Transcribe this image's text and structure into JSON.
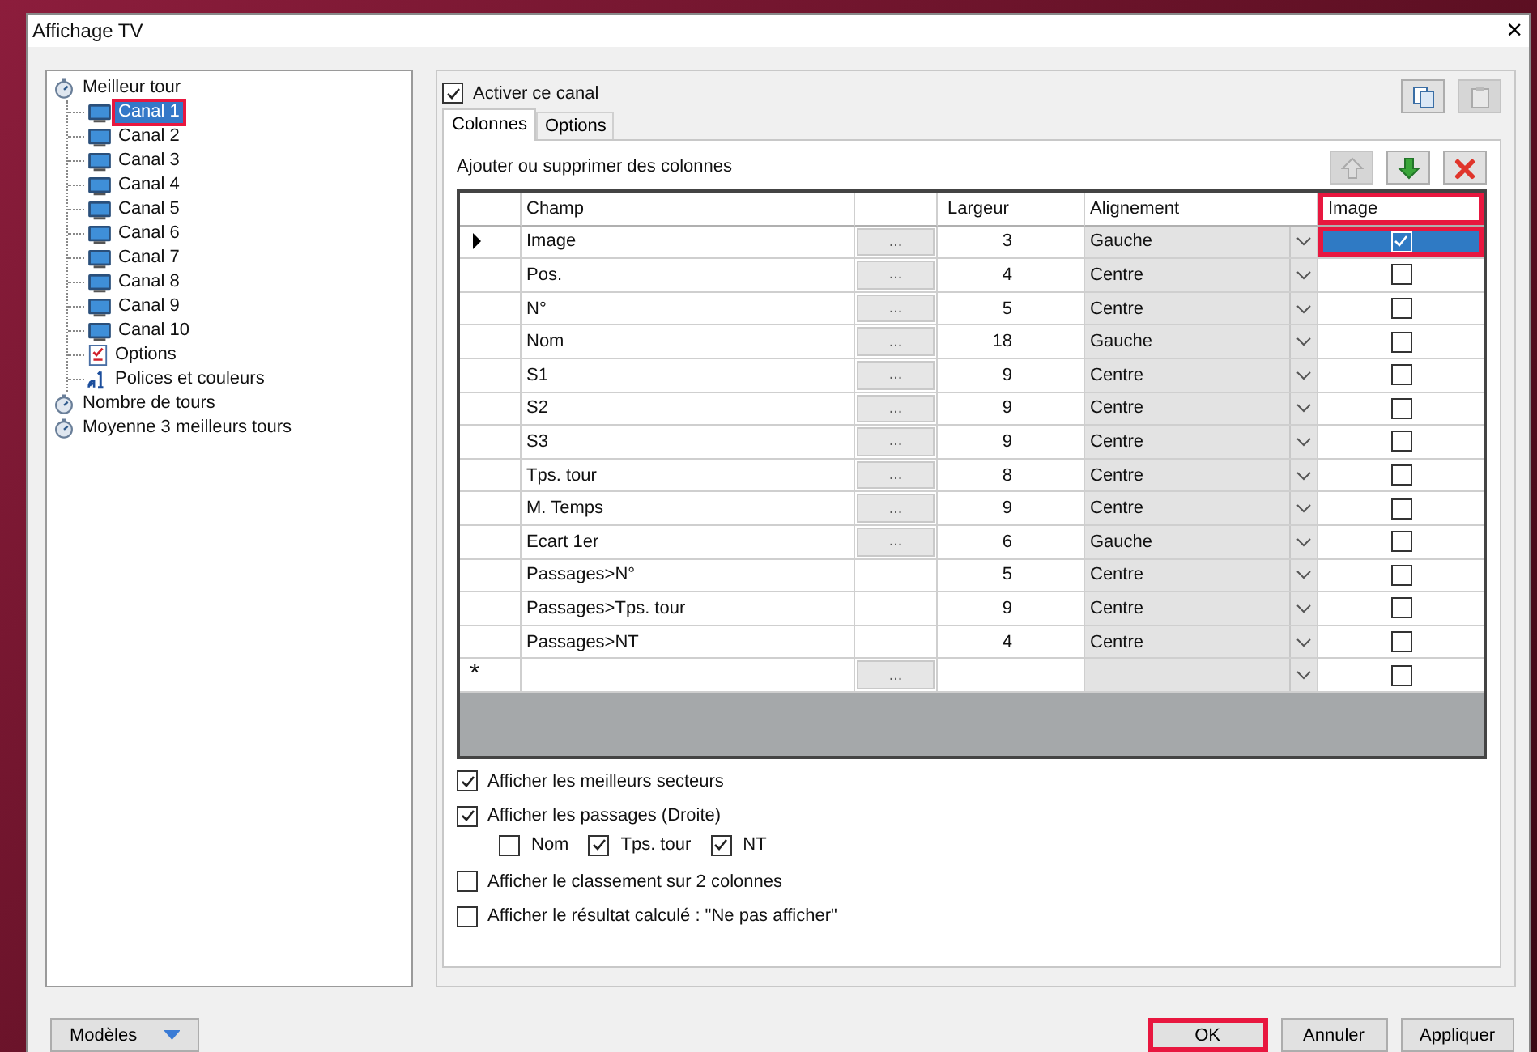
{
  "window": {
    "title": "Affichage TV",
    "close": "×"
  },
  "tree": [
    {
      "label": "Meilleur tour",
      "selected": false,
      "expanded": true,
      "children": [
        {
          "label": "Canal 1",
          "kind": "channel",
          "selected": true,
          "highlight": true
        },
        {
          "label": "Canal 2",
          "kind": "channel",
          "selected": false,
          "highlight": false
        },
        {
          "label": "Canal 3",
          "kind": "channel",
          "selected": false,
          "highlight": false
        },
        {
          "label": "Canal 4",
          "kind": "channel",
          "selected": false,
          "highlight": false
        },
        {
          "label": "Canal 5",
          "kind": "channel",
          "selected": false,
          "highlight": false
        },
        {
          "label": "Canal 6",
          "kind": "channel",
          "selected": false,
          "highlight": false
        },
        {
          "label": "Canal 7",
          "kind": "channel",
          "selected": false,
          "highlight": false
        },
        {
          "label": "Canal 8",
          "kind": "channel",
          "selected": false,
          "highlight": false
        },
        {
          "label": "Canal 9",
          "kind": "channel",
          "selected": false,
          "highlight": false
        },
        {
          "label": "Canal 10",
          "kind": "channel",
          "selected": false,
          "highlight": false
        },
        {
          "label": "Options",
          "kind": "options",
          "selected": false,
          "highlight": false
        },
        {
          "label": "Polices et couleurs",
          "kind": "fonts",
          "selected": false,
          "highlight": false
        }
      ]
    },
    {
      "label": "Nombre de tours",
      "selected": false
    },
    {
      "label": "Moyenne 3 meilleurs tours",
      "selected": false
    }
  ],
  "enable": {
    "label": "Activer ce canal",
    "checked": true
  },
  "clipboard": [
    {
      "kind": "copy",
      "disabled": false
    },
    {
      "kind": "paste",
      "disabled": true
    }
  ],
  "tabs": [
    {
      "label": "Colonnes",
      "selected": true
    },
    {
      "label": "Options",
      "selected": false
    }
  ],
  "section_label": "Ajouter ou supprimer des colonnes",
  "row_tools": [
    {
      "kind": "up",
      "disabled": true
    },
    {
      "kind": "down",
      "disabled": false
    },
    {
      "kind": "delete",
      "disabled": false
    }
  ],
  "grid": {
    "columns": [
      {
        "label": "Champ",
        "highlight": false
      },
      {
        "label": "Largeur",
        "highlight": false
      },
      {
        "label": "Alignement",
        "highlight": false
      },
      {
        "label": "Image",
        "highlight": true
      }
    ],
    "rows": [
      {
        "selected": true,
        "champ": "Image",
        "edit": "...",
        "largeur": "3",
        "alignement": "Gauche",
        "image": true
      },
      {
        "selected": false,
        "champ": "Pos.",
        "edit": "...",
        "largeur": "4",
        "alignement": "Centre",
        "image": false
      },
      {
        "selected": false,
        "champ": "N°",
        "edit": "...",
        "largeur": "5",
        "alignement": "Centre",
        "image": false
      },
      {
        "selected": false,
        "champ": "Nom",
        "edit": "...",
        "largeur": "18",
        "alignement": "Gauche",
        "image": false
      },
      {
        "selected": false,
        "champ": "S1",
        "edit": "...",
        "largeur": "9",
        "alignement": "Centre",
        "image": false
      },
      {
        "selected": false,
        "champ": "S2",
        "edit": "...",
        "largeur": "9",
        "alignement": "Centre",
        "image": false
      },
      {
        "selected": false,
        "champ": "S3",
        "edit": "...",
        "largeur": "9",
        "alignement": "Centre",
        "image": false
      },
      {
        "selected": false,
        "champ": "Tps. tour",
        "edit": "...",
        "largeur": "8",
        "alignement": "Centre",
        "image": false
      },
      {
        "selected": false,
        "champ": "M. Temps",
        "edit": "...",
        "largeur": "9",
        "alignement": "Centre",
        "image": false
      },
      {
        "selected": false,
        "champ": "Ecart 1er",
        "edit": "...",
        "largeur": "6",
        "alignement": "Gauche",
        "image": false
      },
      {
        "selected": false,
        "champ": "Passages>N°",
        "largeur": "5",
        "alignement": "Centre",
        "image": false
      },
      {
        "selected": false,
        "champ": "Passages>Tps. tour",
        "largeur": "9",
        "alignement": "Centre",
        "image": false
      },
      {
        "selected": false,
        "champ": "Passages>NT",
        "largeur": "4",
        "alignement": "Centre",
        "image": false
      }
    ],
    "new_row": {
      "marker": "*",
      "edit": "...",
      "image": false
    }
  },
  "options": [
    {
      "label": "Afficher les meilleurs secteurs",
      "checked": true
    },
    {
      "label": "Afficher les passages (Droite)",
      "checked": true,
      "children": [
        {
          "label": "Nom",
          "checked": false
        },
        {
          "label": "Tps. tour",
          "checked": true
        },
        {
          "label": "NT",
          "checked": true
        }
      ]
    },
    {
      "label": "Afficher le classement sur 2 colonnes",
      "checked": false
    },
    {
      "label": "Afficher le résultat calculé : \"Ne pas afficher\"",
      "checked": false
    }
  ],
  "models_button": "Modèles",
  "buttons": [
    {
      "label": "OK",
      "highlight": true
    },
    {
      "label": "Annuler",
      "highlight": false
    },
    {
      "label": "Appliquer",
      "highlight": false
    }
  ]
}
